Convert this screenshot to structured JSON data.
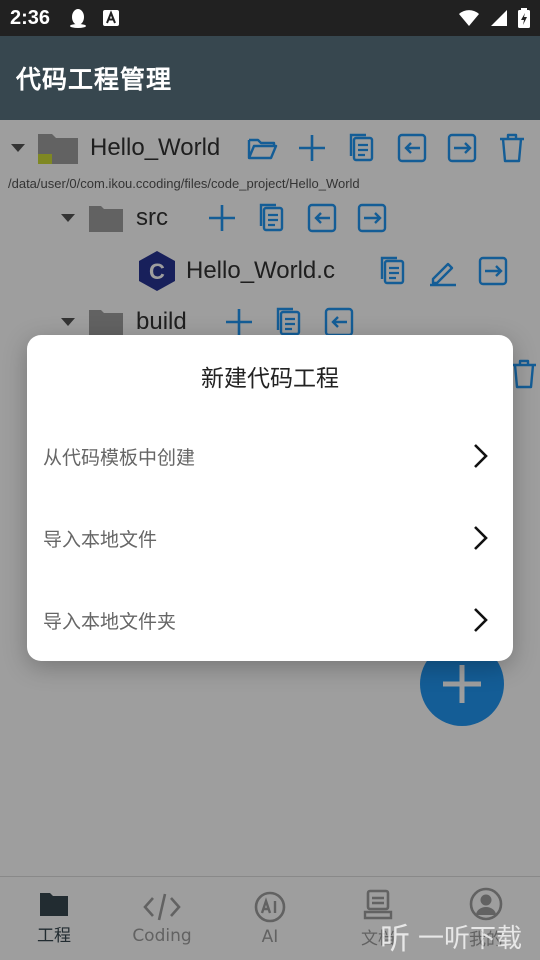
{
  "status_bar": {
    "time": "2:36"
  },
  "app_bar": {
    "title": "代码工程管理"
  },
  "tree": {
    "root": {
      "name": "Hello_World",
      "path": "/data/user/0/com.ikou.ccoding/files/code_project/Hello_World"
    },
    "src": {
      "name": "src"
    },
    "file": {
      "name": "Hello_World.c",
      "badge": "C"
    },
    "build": {
      "name": "build"
    }
  },
  "dialog": {
    "title": "新建代码工程",
    "options": [
      {
        "label": "从代码模板中创建"
      },
      {
        "label": "导入本地文件"
      },
      {
        "label": "导入本地文件夹"
      }
    ]
  },
  "bottom_nav": {
    "items": [
      {
        "label": "工程",
        "icon": "folder-icon",
        "active": true
      },
      {
        "label": "Coding",
        "icon": "code-icon"
      },
      {
        "label": "AI",
        "icon": "ai-icon"
      },
      {
        "label": "文档",
        "icon": "document-icon"
      },
      {
        "label": "我的",
        "icon": "profile-icon"
      }
    ]
  },
  "watermark": {
    "glyph": "听",
    "text": "一听下载"
  },
  "colors": {
    "app_bar": "#37474f",
    "accent": "#2196f3",
    "status_bar": "#212121"
  }
}
